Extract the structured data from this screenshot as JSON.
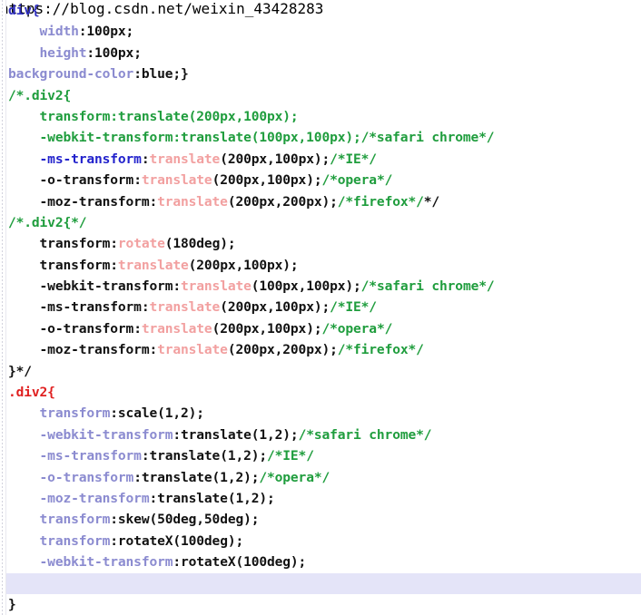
{
  "editor": {
    "watermark": "https://blog.csdn.net/weixin_43428283",
    "language": "CSS",
    "colors": {
      "background": "#ffffff",
      "selector_blue": "#2f2fc0",
      "selector_red": "#e02020",
      "property_periwinkle": "#8b8bd0",
      "property_blue": "#2222cc",
      "property_dark": "#111111",
      "value_black": "#111111",
      "function_pink": "#f2a0a0",
      "comment_green": "#1f9d3d",
      "current_line_highlight": "#e4e4f8",
      "watermark_gray": "#f0f0f0"
    }
  },
  "lines": [
    {
      "id": "l1",
      "fold": "box",
      "tokens": [
        {
          "text": "div{",
          "cls": "t-sel"
        }
      ]
    },
    {
      "id": "l2",
      "fold": "none",
      "tokens": [
        {
          "text": "    width",
          "cls": "t-prop"
        },
        {
          "text": ":100px;",
          "cls": "t-val"
        }
      ]
    },
    {
      "id": "l3",
      "fold": "none",
      "tokens": [
        {
          "text": "    height",
          "cls": "t-prop"
        },
        {
          "text": ":100px;",
          "cls": "t-val"
        }
      ]
    },
    {
      "id": "l4",
      "fold": "tick",
      "tokens": [
        {
          "text": "background-color",
          "cls": "t-prop"
        },
        {
          "text": ":blue;}",
          "cls": "t-val"
        }
      ]
    },
    {
      "id": "l5",
      "fold": "box",
      "tokens": [
        {
          "text": "/*.div2{",
          "cls": "t-comment"
        }
      ]
    },
    {
      "id": "l6",
      "fold": "none",
      "tokens": [
        {
          "text": "    transform:translate(200px,100px);",
          "cls": "t-comment"
        }
      ]
    },
    {
      "id": "l7",
      "fold": "tick",
      "tokens": [
        {
          "text": "    -webkit-transform:translate(100px,100px);/*safari chrome*/",
          "cls": "t-comment"
        }
      ]
    },
    {
      "id": "l8",
      "fold": "none",
      "tokens": [
        {
          "text": "    -ms-transform",
          "cls": "t-prop-blue"
        },
        {
          "text": ":",
          "cls": "t-val"
        },
        {
          "text": "translate",
          "cls": "t-fn"
        },
        {
          "text": "(200px,100px);",
          "cls": "t-val"
        },
        {
          "text": "/*IE*/",
          "cls": "t-comment"
        }
      ]
    },
    {
      "id": "l9",
      "fold": "none",
      "tokens": [
        {
          "text": "    -o-transform",
          "cls": "t-prop-dark"
        },
        {
          "text": ":",
          "cls": "t-val"
        },
        {
          "text": "translate",
          "cls": "t-fn"
        },
        {
          "text": "(200px,100px);",
          "cls": "t-val"
        },
        {
          "text": "/*opera*/",
          "cls": "t-comment"
        }
      ]
    },
    {
      "id": "l10",
      "fold": "none",
      "tokens": [
        {
          "text": "    -moz-transform",
          "cls": "t-prop-dark"
        },
        {
          "text": ":",
          "cls": "t-val"
        },
        {
          "text": "translate",
          "cls": "t-fn"
        },
        {
          "text": "(200px,200px);",
          "cls": "t-val"
        },
        {
          "text": "/*firefox*/",
          "cls": "t-comment"
        },
        {
          "text": "*/",
          "cls": "t-val"
        }
      ]
    },
    {
      "id": "l11",
      "fold": "none",
      "tokens": [
        {
          "text": "/*.div2{*/",
          "cls": "t-comment"
        }
      ]
    },
    {
      "id": "l12",
      "fold": "none",
      "tokens": [
        {
          "text": "    transform",
          "cls": "t-prop-dark"
        },
        {
          "text": ":",
          "cls": "t-val"
        },
        {
          "text": "rotate",
          "cls": "t-fn"
        },
        {
          "text": "(180deg);",
          "cls": "t-val"
        }
      ]
    },
    {
      "id": "l13",
      "fold": "none",
      "tokens": [
        {
          "text": "    transform",
          "cls": "t-prop-dark"
        },
        {
          "text": ":",
          "cls": "t-val"
        },
        {
          "text": "translate",
          "cls": "t-fn"
        },
        {
          "text": "(200px,100px);",
          "cls": "t-val"
        }
      ]
    },
    {
      "id": "l14",
      "fold": "none",
      "tokens": [
        {
          "text": "    -webkit-transform",
          "cls": "t-prop-dark"
        },
        {
          "text": ":",
          "cls": "t-val"
        },
        {
          "text": "translate",
          "cls": "t-fn"
        },
        {
          "text": "(100px,100px);",
          "cls": "t-val"
        },
        {
          "text": "/*safari chrome*/",
          "cls": "t-comment"
        }
      ]
    },
    {
      "id": "l15",
      "fold": "none",
      "tokens": [
        {
          "text": "    -ms-transform",
          "cls": "t-prop-dark"
        },
        {
          "text": ":",
          "cls": "t-val"
        },
        {
          "text": "translate",
          "cls": "t-fn"
        },
        {
          "text": "(200px,100px);",
          "cls": "t-val"
        },
        {
          "text": "/*IE*/",
          "cls": "t-comment"
        }
      ]
    },
    {
      "id": "l16",
      "fold": "none",
      "tokens": [
        {
          "text": "    -o-transform",
          "cls": "t-prop-dark"
        },
        {
          "text": ":",
          "cls": "t-val"
        },
        {
          "text": "translate",
          "cls": "t-fn"
        },
        {
          "text": "(200px,100px);",
          "cls": "t-val"
        },
        {
          "text": "/*opera*/",
          "cls": "t-comment"
        }
      ]
    },
    {
      "id": "l17",
      "fold": "none",
      "tokens": [
        {
          "text": "    -moz-transform",
          "cls": "t-prop-dark"
        },
        {
          "text": ":",
          "cls": "t-val"
        },
        {
          "text": "translate",
          "cls": "t-fn"
        },
        {
          "text": "(200px,200px);",
          "cls": "t-val"
        },
        {
          "text": "/*firefox*/",
          "cls": "t-comment"
        }
      ]
    },
    {
      "id": "l18",
      "fold": "none",
      "tokens": [
        {
          "text": "}*/",
          "cls": "t-val"
        }
      ]
    },
    {
      "id": "l19",
      "fold": "box-red",
      "tokens": [
        {
          "text": ".div2{",
          "cls": "t-sel-red"
        }
      ]
    },
    {
      "id": "l20",
      "fold": "none",
      "tokens": [
        {
          "text": "    transform",
          "cls": "t-prop"
        },
        {
          "text": ":scale(1,2);",
          "cls": "t-val"
        }
      ]
    },
    {
      "id": "l21",
      "fold": "none",
      "tokens": [
        {
          "text": "    -webkit-transform",
          "cls": "t-prop"
        },
        {
          "text": ":translate(1,2);",
          "cls": "t-val"
        },
        {
          "text": "/*safari chrome*/",
          "cls": "t-comment"
        }
      ]
    },
    {
      "id": "l22",
      "fold": "none",
      "tokens": [
        {
          "text": "    -ms-transform",
          "cls": "t-prop"
        },
        {
          "text": ":translate(1,2);",
          "cls": "t-val"
        },
        {
          "text": "/*IE*/",
          "cls": "t-comment"
        }
      ]
    },
    {
      "id": "l23",
      "fold": "none",
      "tokens": [
        {
          "text": "    -o-transform",
          "cls": "t-prop"
        },
        {
          "text": ":translate(1,2);",
          "cls": "t-val"
        },
        {
          "text": "/*opera*/",
          "cls": "t-comment"
        }
      ]
    },
    {
      "id": "l24",
      "fold": "none",
      "tokens": [
        {
          "text": "    -moz-transform",
          "cls": "t-prop"
        },
        {
          "text": ":translate(1,2);",
          "cls": "t-val"
        }
      ]
    },
    {
      "id": "l25",
      "fold": "none",
      "tokens": [
        {
          "text": "    transform",
          "cls": "t-prop"
        },
        {
          "text": ":skew(50deg,50deg);",
          "cls": "t-val"
        }
      ]
    },
    {
      "id": "l26",
      "fold": "none",
      "tokens": [
        {
          "text": "    transform",
          "cls": "t-prop"
        },
        {
          "text": ":rotateX(100deg);",
          "cls": "t-val"
        }
      ]
    },
    {
      "id": "l27",
      "fold": "none",
      "tokens": [
        {
          "text": "    -webkit-transform",
          "cls": "t-prop"
        },
        {
          "text": ":rotateX(100deg);",
          "cls": "t-val"
        }
      ]
    },
    {
      "id": "l28",
      "fold": "none",
      "current": true,
      "tokens": []
    },
    {
      "id": "l29",
      "fold": "none",
      "tokens": [
        {
          "text": "}",
          "cls": "t-val"
        }
      ]
    }
  ]
}
